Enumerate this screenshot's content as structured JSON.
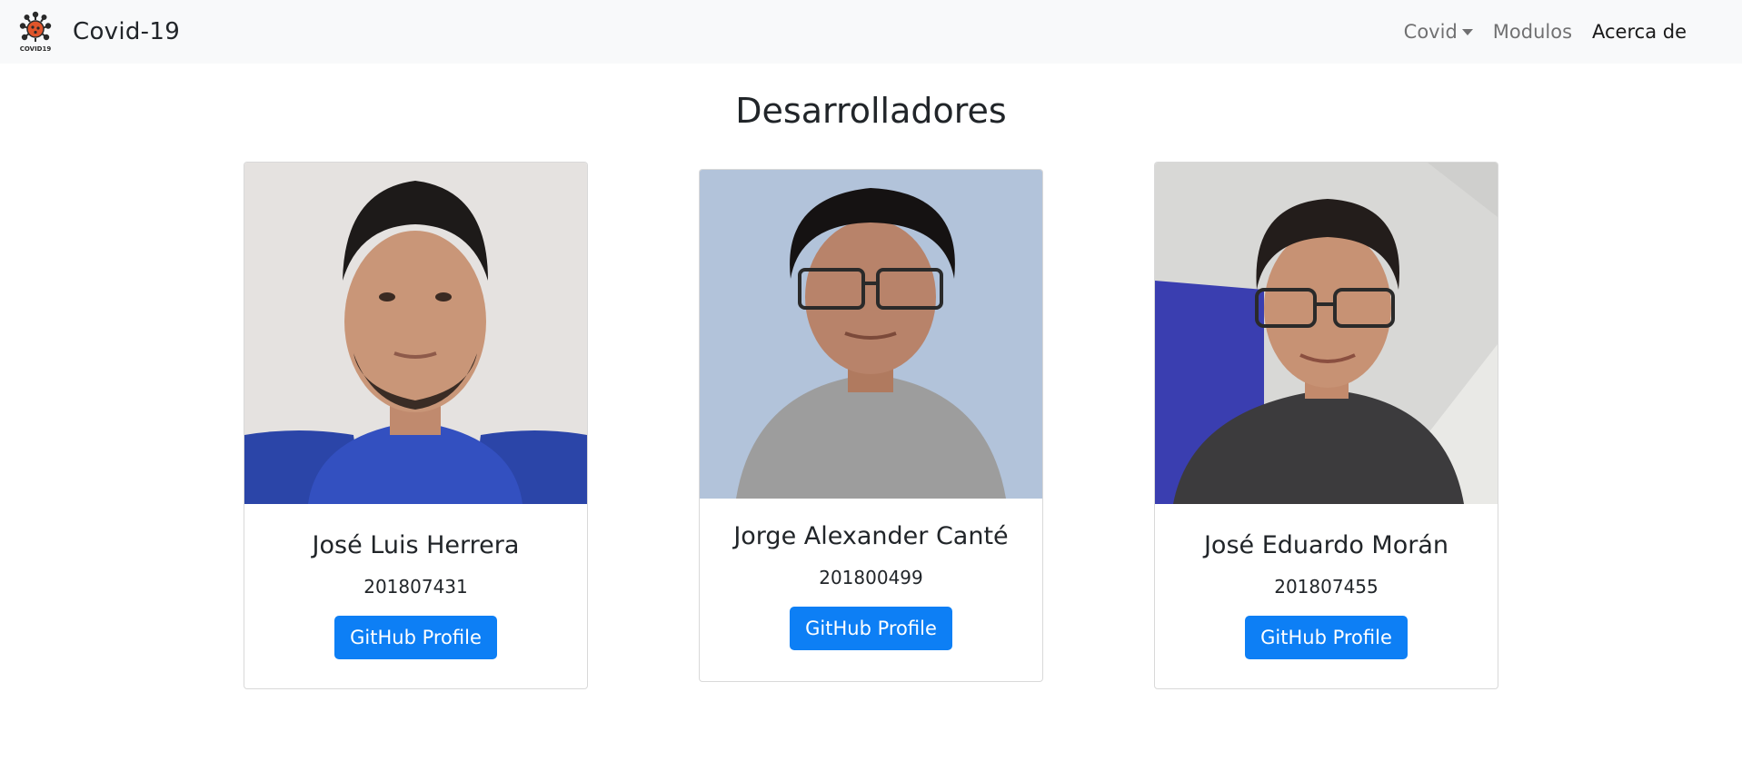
{
  "navbar": {
    "brand_logo_text": "COVID19",
    "brand_title": "Covid-19",
    "links": [
      {
        "label": "Covid",
        "icon": "caret-down-icon"
      },
      {
        "label": "Modulos"
      },
      {
        "label": "Acerca de"
      }
    ]
  },
  "page": {
    "title": "Desarrolladores"
  },
  "developers": [
    {
      "name": "José Luis Herrera",
      "id": "201807431",
      "button_label": "GitHub Profile"
    },
    {
      "name": "Jorge Alexander Canté",
      "id": "201800499",
      "button_label": "GitHub Profile"
    },
    {
      "name": "José Eduardo Morán",
      "id": "201807455",
      "button_label": "GitHub Profile"
    }
  ],
  "colors": {
    "navbar_bg": "#f8f9fa",
    "button_bg": "#0d7ff5",
    "logo_accent": "#e0552b"
  }
}
